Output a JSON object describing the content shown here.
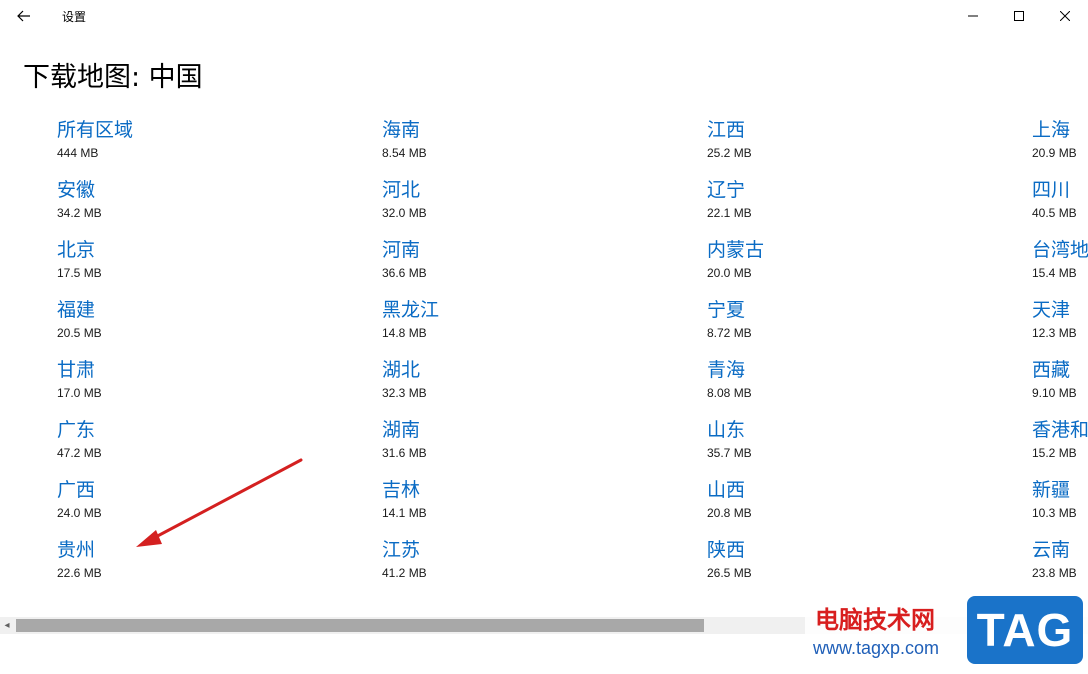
{
  "window": {
    "title": "设置"
  },
  "page": {
    "title": "下载地图: 中国"
  },
  "columns": [
    [
      {
        "name": "所有区域",
        "size": "444 MB"
      },
      {
        "name": "安徽",
        "size": "34.2 MB"
      },
      {
        "name": "北京",
        "size": "17.5 MB"
      },
      {
        "name": "福建",
        "size": "20.5 MB"
      },
      {
        "name": "甘肃",
        "size": "17.0 MB"
      },
      {
        "name": "广东",
        "size": "47.2 MB"
      },
      {
        "name": "广西",
        "size": "24.0 MB"
      },
      {
        "name": "贵州",
        "size": "22.6 MB"
      }
    ],
    [
      {
        "name": "海南",
        "size": "8.54 MB"
      },
      {
        "name": "河北",
        "size": "32.0 MB"
      },
      {
        "name": "河南",
        "size": "36.6 MB"
      },
      {
        "name": "黑龙江",
        "size": "14.8 MB"
      },
      {
        "name": "湖北",
        "size": "32.3 MB"
      },
      {
        "name": "湖南",
        "size": "31.6 MB"
      },
      {
        "name": "吉林",
        "size": "14.1 MB"
      },
      {
        "name": "江苏",
        "size": "41.2 MB"
      }
    ],
    [
      {
        "name": "江西",
        "size": "25.2 MB"
      },
      {
        "name": "辽宁",
        "size": "22.1 MB"
      },
      {
        "name": "内蒙古",
        "size": "20.0 MB"
      },
      {
        "name": "宁夏",
        "size": "8.72 MB"
      },
      {
        "name": "青海",
        "size": "8.08 MB"
      },
      {
        "name": "山东",
        "size": "35.7 MB"
      },
      {
        "name": "山西",
        "size": "20.8 MB"
      },
      {
        "name": "陕西",
        "size": "26.5 MB"
      }
    ],
    [
      {
        "name": "上海",
        "size": "20.9 MB"
      },
      {
        "name": "四川",
        "size": "40.5 MB"
      },
      {
        "name": "台湾地",
        "size": "15.4 MB"
      },
      {
        "name": "天津",
        "size": "12.3 MB"
      },
      {
        "name": "西藏",
        "size": "9.10 MB"
      },
      {
        "name": "香港和",
        "size": "15.2 MB"
      },
      {
        "name": "新疆",
        "size": "10.3 MB"
      },
      {
        "name": "云南",
        "size": "23.8 MB"
      }
    ]
  ],
  "watermark": {
    "site_name": "电脑技术网",
    "url": "www.tagxp.com",
    "badge": "TAG"
  },
  "colors": {
    "link": "#0a6bc4",
    "annotation_arrow": "#d42020",
    "scroll_thumb": "#a8a8a8"
  },
  "icons": {
    "back": "arrow-left",
    "minimize": "minus",
    "maximize": "square",
    "close": "x",
    "scroll_left": "triangle-left"
  }
}
